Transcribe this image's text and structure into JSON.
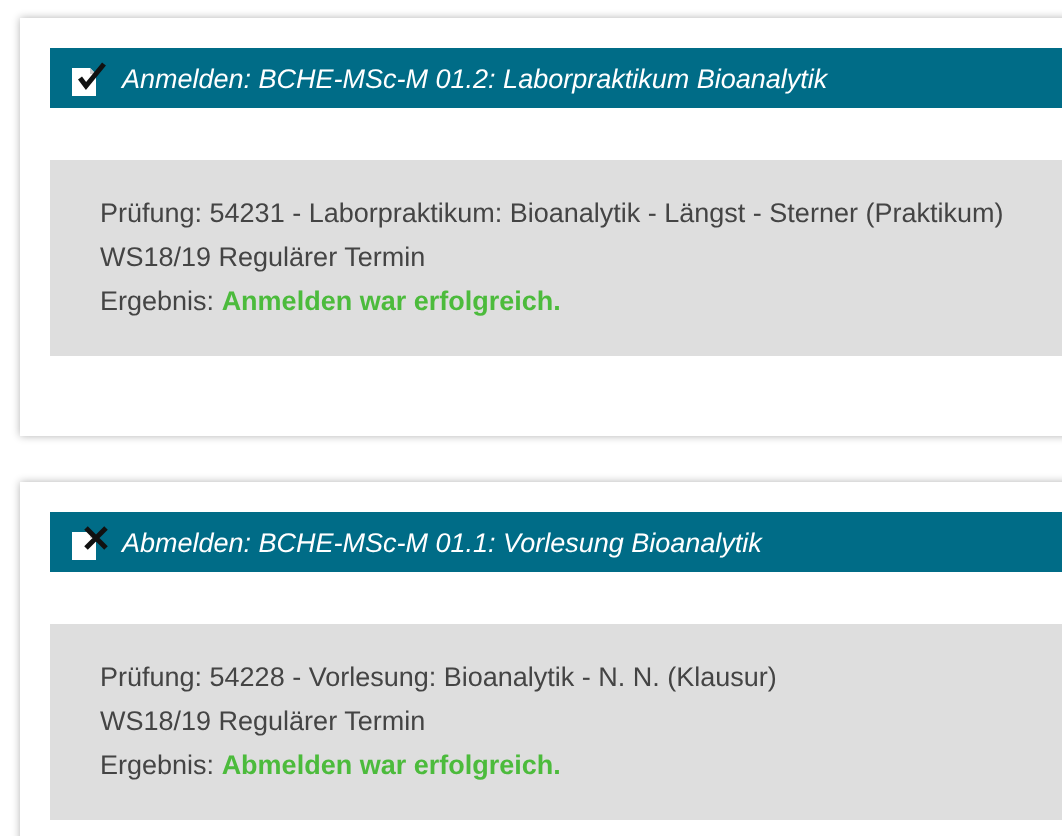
{
  "cards": [
    {
      "kind": "register",
      "title": "Anmelden: BCHE-MSc-M 01.2: Laborpraktikum Bioanalytik",
      "lines": [
        "Prüfung: 54231 - Laborpraktikum: Bioanalytik - Längst - Sterner (Praktikum)",
        "WS18/19 Regulärer Termin"
      ],
      "result": {
        "label": "Ergebnis:",
        "text": "Anmelden war erfolgreich.",
        "kind": "success"
      }
    },
    {
      "kind": "deregister",
      "title": "Abmelden: BCHE-MSc-M 01.1: Vorlesung Bioanalytik",
      "lines": [
        "Prüfung: 54228 - Vorlesung: Bioanalytik - N. N. (Klausur)",
        "WS18/19 Regulärer Termin"
      ],
      "result": {
        "label": "Ergebnis:",
        "text": "Abmelden war erfolgreich.",
        "kind": "success"
      }
    }
  ]
}
